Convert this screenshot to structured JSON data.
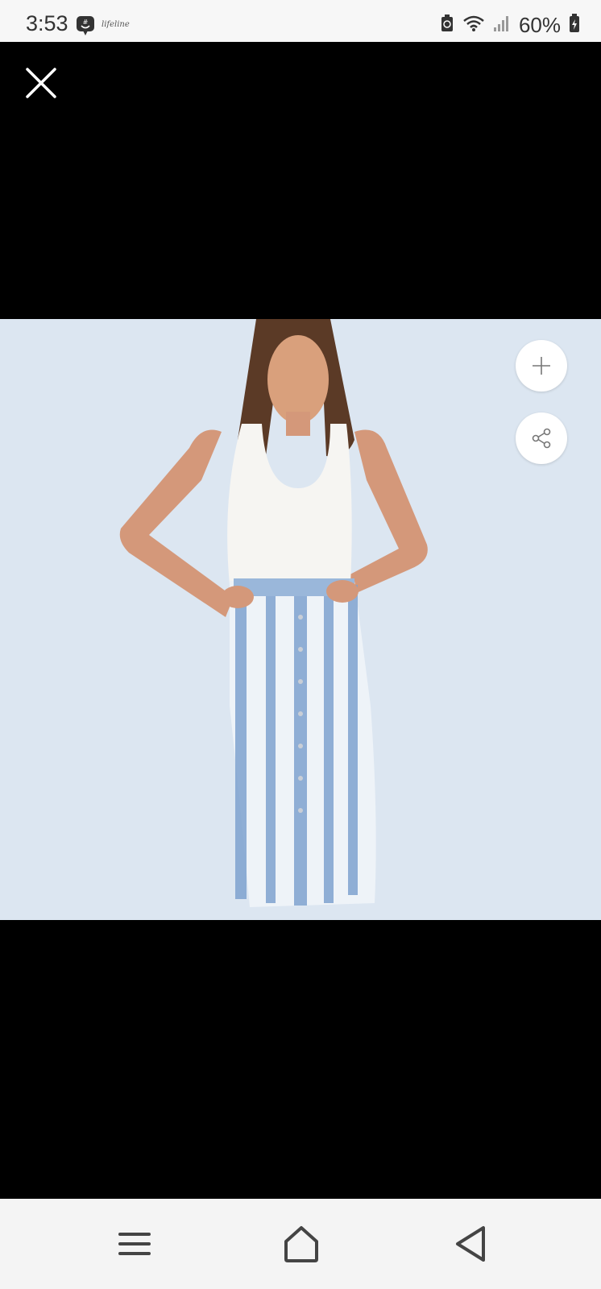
{
  "status_bar": {
    "time": "3:53",
    "app_script": "lifeline",
    "battery_percent": "60%",
    "icons": [
      "groupme-icon",
      "battery-saver-icon",
      "wifi-icon",
      "signal-icon",
      "battery-icon"
    ]
  },
  "viewer": {
    "close_icon": "close-icon",
    "zoom_icon": "plus-icon",
    "share_icon": "share-icon",
    "image_subject": "model-white-tank-denim-skirt",
    "image_background": "#dce6f1"
  },
  "nav_bar": {
    "icons": [
      "recent-apps-icon",
      "home-icon",
      "back-icon"
    ]
  }
}
